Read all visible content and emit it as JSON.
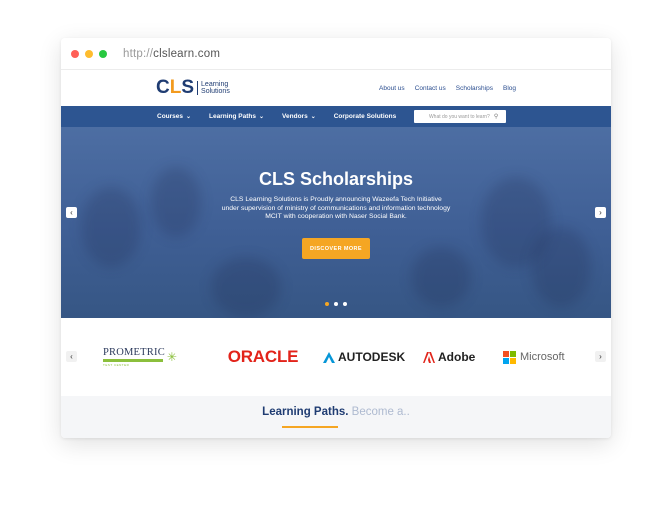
{
  "browser": {
    "url_protocol": "http://",
    "url_host": "clslearn.com",
    "colors": {
      "close": "#ff5f57",
      "minimize": "#febc2e",
      "maximize": "#28c840"
    }
  },
  "header": {
    "logo_text_c": "C",
    "logo_text_l": "L",
    "logo_text_s": "S",
    "logo_sub_1": "Learning",
    "logo_sub_2": "Solutions",
    "links": [
      "About us",
      "Contact us",
      "Scholarships",
      "Blog"
    ]
  },
  "nav": {
    "items": [
      "Courses",
      "Learning Paths",
      "Vendors",
      "Corporate Solutions"
    ],
    "search_placeholder": "What do you want to learn?"
  },
  "hero": {
    "title": "CLS Scholarships",
    "text": "CLS Learning Solutions is Proudly announcing Wazeefa Tech Initiative under supervision of ministry of communications and information technology MCIT with cooperation with Naser Social Bank.",
    "cta": "DISCOVER MORE",
    "slides": 3,
    "active_slide": 1
  },
  "partners": {
    "logos": [
      "PROMETRIC",
      "ORACLE",
      "AUTODESK",
      "Adobe",
      "Microsoft"
    ],
    "prometric_sub": "TEST CENTER"
  },
  "bottom": {
    "title_main": "Learning Paths.",
    "title_faded": "Become a.."
  },
  "theme": {
    "navy": "#2d5591",
    "orange": "#f5a623",
    "oracle_red": "#e2231a"
  }
}
